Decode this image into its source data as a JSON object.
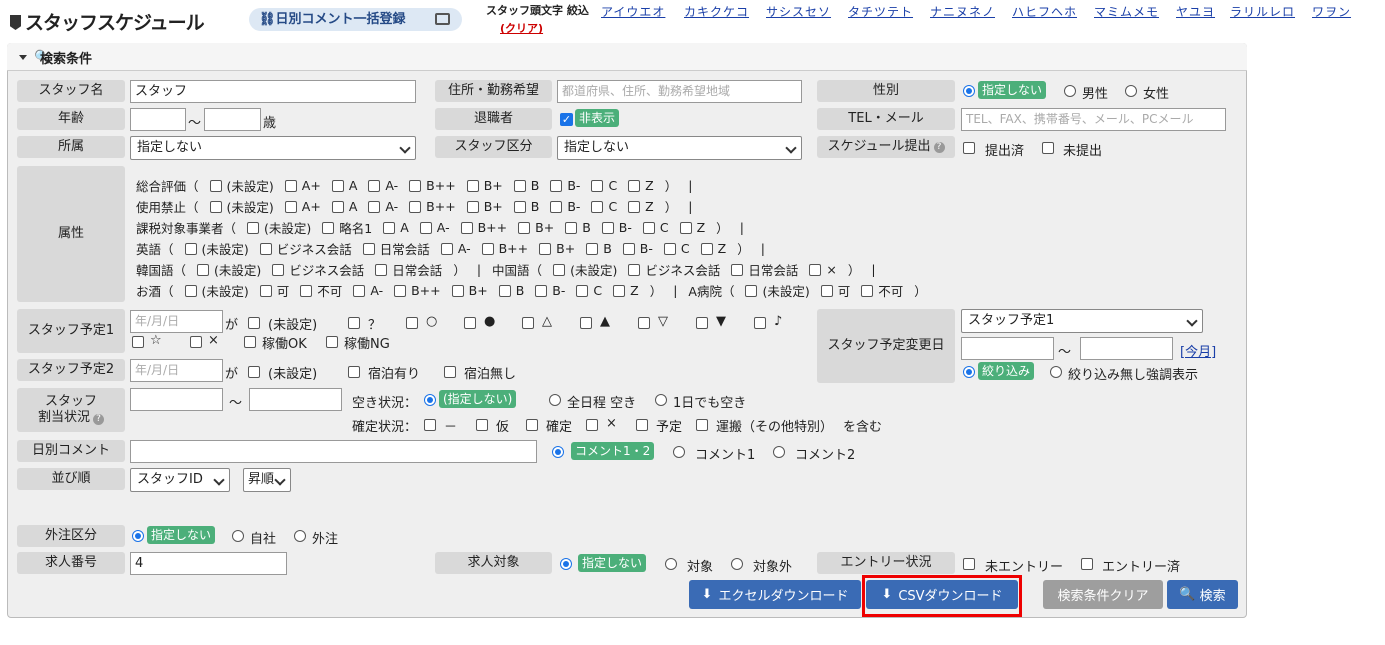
{
  "header": {
    "title": "スタッフスケジュール",
    "bulk_btn": "日別コメント一括登録",
    "kana_label": "スタッフ頭文字 絞込",
    "kana_clear": "(クリア)",
    "kana": [
      "アイウエオ",
      "カキクケコ",
      "サシスセソ",
      "タチツテト",
      "ナニヌネノ",
      "ハヒフヘホ",
      "マミムメモ",
      "ヤユヨ",
      "ラリルレロ",
      "ワヲン"
    ]
  },
  "panel": {
    "title": "検索条件"
  },
  "labels": {
    "staff_name": "スタッフ名",
    "address": "住所・勤務希望",
    "gender": "性別",
    "age": "年齢",
    "retired": "退職者",
    "tel": "TEL・メール",
    "affiliation": "所属",
    "staff_type": "スタッフ区分",
    "schedule_submit": "スケジュール提出",
    "attr": "属性",
    "plan1": "スタッフ予定1",
    "plan2": "スタッフ予定2",
    "plan_change": "スタッフ予定変更日",
    "assign_a": "スタッフ",
    "assign_b": "割当状況",
    "daily_comment": "日別コメント",
    "sort": "並び順",
    "outsource": "外注区分",
    "job_no": "求人番号",
    "job_target": "求人対象",
    "entry": "エントリー状況"
  },
  "fields": {
    "staff_name": "スタッフ",
    "address_ph": "都道府県、住所、勤務希望地域",
    "tel_ph": "TEL、FAX、携帯番号、メール、PCメール",
    "age_sep": "～",
    "age_unit": "歳",
    "affiliation": "指定しない",
    "staff_type": "指定しない",
    "plan1_ph": "年/月/日",
    "plan2_ph": "年/月/日",
    "plan_change_sel": "スタッフ予定1",
    "range_sep": "～",
    "this_month": "[今月]",
    "sort_field": "スタッフID",
    "sort_order": "昇順",
    "job_no": "4",
    "ga": "が"
  },
  "gender": {
    "all": "指定しない",
    "male": "男性",
    "female": "女性"
  },
  "retired": {
    "hide": "非表示"
  },
  "submit": {
    "done": "提出済",
    "not": "未提出"
  },
  "attr_rows": [
    [
      [
        "総合評価（",
        0
      ],
      [
        "(未設定)",
        1
      ],
      [
        "A+",
        1
      ],
      [
        "A",
        1
      ],
      [
        "A-",
        1
      ],
      [
        "B++",
        1
      ],
      [
        "B+",
        1
      ],
      [
        "B",
        1
      ],
      [
        "B-",
        1
      ],
      [
        "C",
        1
      ],
      [
        "Z",
        1
      ],
      [
        "）",
        0
      ],
      [
        "|",
        0
      ]
    ],
    [
      [
        "使用禁止（",
        0
      ],
      [
        "(未設定)",
        1
      ],
      [
        "A+",
        1
      ],
      [
        "A",
        1
      ],
      [
        "A-",
        1
      ],
      [
        "B++",
        1
      ],
      [
        "B+",
        1
      ],
      [
        "B",
        1
      ],
      [
        "B-",
        1
      ],
      [
        "C",
        1
      ],
      [
        "Z",
        1
      ],
      [
        "）",
        0
      ],
      [
        "|",
        0
      ]
    ],
    [
      [
        "課税対象事業者（",
        0
      ],
      [
        "(未設定)",
        1
      ],
      [
        "略名1",
        1
      ],
      [
        "A",
        1
      ],
      [
        "A-",
        1
      ],
      [
        "B++",
        1
      ],
      [
        "B+",
        1
      ],
      [
        "B",
        1
      ],
      [
        "B-",
        1
      ],
      [
        "C",
        1
      ],
      [
        "Z",
        1
      ],
      [
        "）",
        0
      ],
      [
        "|",
        0
      ]
    ],
    [
      [
        "英語（",
        0
      ],
      [
        "(未設定)",
        1
      ],
      [
        "ビジネス会話",
        1
      ],
      [
        "日常会話",
        1
      ],
      [
        "A-",
        1
      ],
      [
        "B++",
        1
      ],
      [
        "B+",
        1
      ],
      [
        "B",
        1
      ],
      [
        "B-",
        1
      ],
      [
        "C",
        1
      ],
      [
        "Z",
        1
      ],
      [
        "）",
        0
      ],
      [
        "|",
        0
      ]
    ],
    [
      [
        "韓国語（",
        0
      ],
      [
        "(未設定)",
        1
      ],
      [
        "ビジネス会話",
        1
      ],
      [
        "日常会話",
        1
      ],
      [
        "）",
        0
      ],
      [
        "|",
        0
      ],
      [
        "中国語（",
        0
      ],
      [
        "(未設定)",
        1
      ],
      [
        "ビジネス会話",
        1
      ],
      [
        "日常会話",
        1
      ],
      [
        "×",
        1
      ],
      [
        "）",
        0
      ],
      [
        "|",
        0
      ]
    ],
    [
      [
        "お酒（",
        0
      ],
      [
        "(未設定)",
        1
      ],
      [
        "可",
        1
      ],
      [
        "不可",
        1
      ],
      [
        "A-",
        1
      ],
      [
        "B++",
        1
      ],
      [
        "B+",
        1
      ],
      [
        "B",
        1
      ],
      [
        "B-",
        1
      ],
      [
        "C",
        1
      ],
      [
        "Z",
        1
      ],
      [
        "）",
        0
      ],
      [
        "|",
        0
      ],
      [
        "A病院（",
        0
      ],
      [
        "(未設定)",
        1
      ],
      [
        "可",
        1
      ],
      [
        "不可",
        1
      ],
      [
        "）",
        0
      ]
    ]
  ],
  "plan1_opts": [
    "(未設定)",
    "？",
    "○",
    "●",
    "△",
    "▲",
    "▽",
    "▼",
    "♪",
    "☆",
    "×",
    "稼働OK",
    "稼働NG"
  ],
  "plan2_opts": [
    "(未設定)",
    "宿泊有り",
    "宿泊無し"
  ],
  "plan_change": {
    "narrow": "絞り込み",
    "no_narrow": "絞り込み無し強調表示"
  },
  "assign": {
    "vacancy_label": "空き状況：",
    "v_all": "(指定しない)",
    "v_full": "全日程 空き",
    "v_one": "1日でも空き",
    "confirm_label": "確定状況：",
    "c": [
      "－",
      "仮",
      "確定",
      "×",
      "予定",
      "運搬（その他特別）"
    ],
    "include": "を含む"
  },
  "comment": {
    "c12": "コメント1・2",
    "c1": "コメント1",
    "c2": "コメント2"
  },
  "outsource": {
    "all": "指定しない",
    "self": "自社",
    "out": "外注"
  },
  "job_target": {
    "all": "指定しない",
    "target": "対象",
    "non": "対象外"
  },
  "entry": {
    "not": "未エントリー",
    "done": "エントリー済"
  },
  "buttons": {
    "excel": "エクセルダウンロード",
    "csv": "CSVダウンロード",
    "clear": "検索条件クリア",
    "search": "検索"
  }
}
